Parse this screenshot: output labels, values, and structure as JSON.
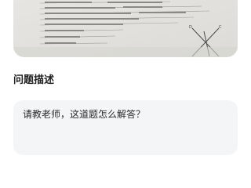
{
  "problem_photo": {
    "description_icon": "problem-photo",
    "visible_fragments": [
      "（∠AB=，OH=cm），此时物体离水面的",
      "（∠AB≈…，OH=cm），此时水面的射",
      "物体水面的位置是",
      "A 大小都变",
      "B 大小不变  方向变化",
      "C 大小  方向都变",
      "D"
    ]
  },
  "section": {
    "title": "问题描述"
  },
  "question": {
    "text": "请教老师，这道题怎么解答？"
  }
}
